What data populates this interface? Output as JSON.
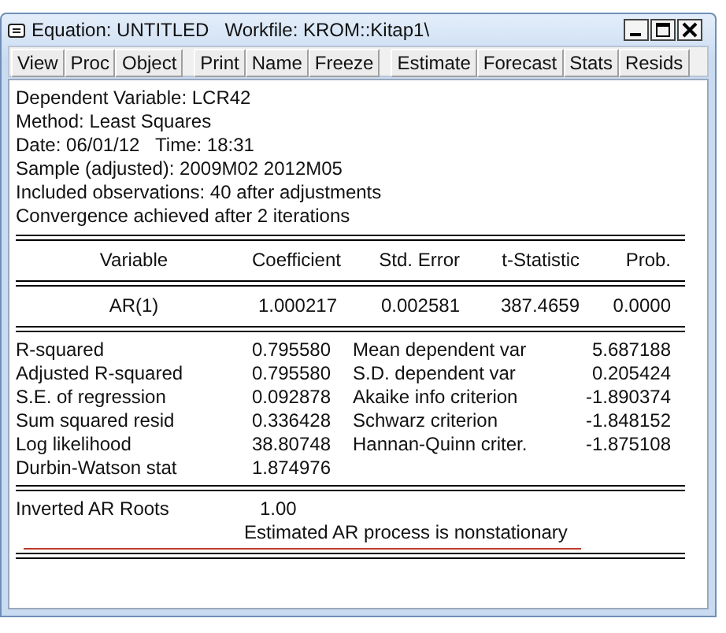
{
  "window": {
    "title": "Equation: UNTITLED   Workfile: KROM::Kitap1\\"
  },
  "toolbar": [
    [
      "View",
      "Proc",
      "Object"
    ],
    [
      "Print",
      "Name",
      "Freeze"
    ],
    [
      "Estimate",
      "Forecast",
      "Stats",
      "Resids"
    ]
  ],
  "header_lines": [
    "Dependent Variable: LCR42",
    "Method: Least Squares",
    "Date: 06/01/12   Time: 18:31",
    "Sample (adjusted): 2009M02 2012M05",
    "Included observations: 40 after adjustments",
    "Convergence achieved after 2 iterations"
  ],
  "table": {
    "columns": [
      "Variable",
      "Coefficient",
      "Std. Error",
      "t-Statistic",
      "Prob."
    ],
    "rows": [
      [
        "AR(1)",
        "1.000217",
        "0.002581",
        "387.4659",
        "0.0000"
      ]
    ]
  },
  "stats": [
    [
      "R-squared",
      "0.795580",
      "Mean dependent var",
      "5.687188"
    ],
    [
      "Adjusted R-squared",
      "0.795580",
      "S.D. dependent var",
      "0.205424"
    ],
    [
      "S.E. of regression",
      "0.092878",
      "Akaike info criterion",
      "-1.890374"
    ],
    [
      "Sum squared resid",
      "0.336428",
      "Schwarz criterion",
      "-1.848152"
    ],
    [
      "Log likelihood",
      "38.80748",
      "Hannan-Quinn criter.",
      "-1.875108"
    ],
    [
      "Durbin-Watson stat",
      "1.874976"
    ]
  ],
  "roots": {
    "label": "Inverted AR Roots",
    "value": "1.00",
    "note": "Estimated AR process is nonstationary",
    "underlined": true
  }
}
